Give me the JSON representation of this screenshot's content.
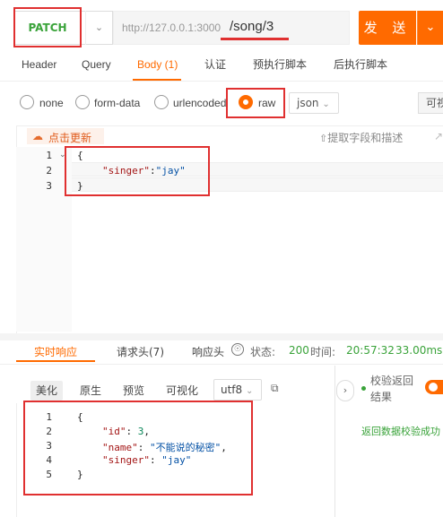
{
  "request": {
    "method": "PATCH",
    "url_base": "http://127.0.0.1:3000",
    "url_path": "/song/3",
    "send_label": "发 送",
    "tabs": [
      "Header",
      "Query",
      "Body (1)",
      "认证",
      "预执行脚本",
      "后执行脚本"
    ],
    "active_tab": "Body (1)",
    "body_types": [
      "none",
      "form-data",
      "urlencoded",
      "raw"
    ],
    "selected_body_type": "raw",
    "format_select": "json",
    "beautify_label": "可视",
    "hot_update_label": "点击更新",
    "extract_label": "提取字段和描述",
    "code_lines": [
      {
        "num": "1",
        "text": "{"
      },
      {
        "num": "2",
        "key": "\"singer\"",
        "sep": ":",
        "value": "\"jay\""
      },
      {
        "num": "3",
        "text": "}"
      }
    ]
  },
  "response": {
    "tabs": [
      "实时响应",
      "请求头(7)",
      "响应头"
    ],
    "active_tab": "实时响应",
    "status_label": "状态:",
    "status_value": "200",
    "time_label": "时间:",
    "time_value": "20:57:32",
    "duration_value": "33.00ms",
    "view_tabs": [
      "美化",
      "原生",
      "预览",
      "可视化"
    ],
    "active_view": "美化",
    "encoding": "utf8",
    "validate_label": "校验返回结果",
    "validate_link": "返回数据校验成功",
    "validate_enabled": true,
    "code_lines": [
      {
        "num": "1",
        "text": "{"
      },
      {
        "num": "2",
        "key": "\"id\"",
        "sep": ": ",
        "value": "3",
        "comma": ","
      },
      {
        "num": "3",
        "key": "\"name\"",
        "sep": ": ",
        "value": "\"不能说的秘密\"",
        "comma": ","
      },
      {
        "num": "4",
        "key": "\"singer\"",
        "sep": ": ",
        "value": "\"jay\""
      },
      {
        "num": "5",
        "text": "}"
      }
    ]
  },
  "colors": {
    "accent": "#ff6a00",
    "method_green": "#3aa33a",
    "annotation_red": "#e03030"
  }
}
